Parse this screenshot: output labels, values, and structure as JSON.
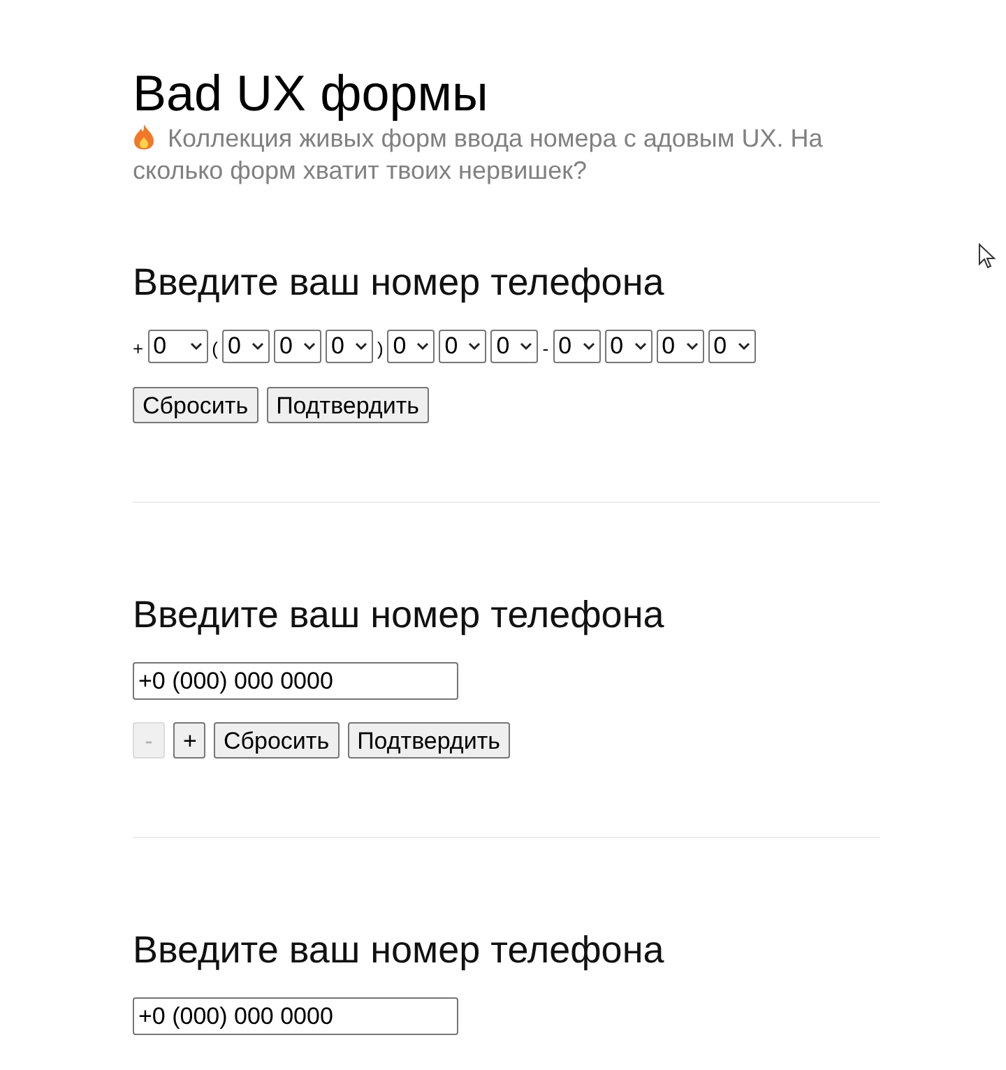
{
  "title": "Bad UX формы",
  "subtitle": "Коллекция живых форм ввода номера с адовым UX. На сколько форм хватит твоих нервишек?",
  "sections": [
    {
      "kind": "selects",
      "heading": "Введите ваш номер телефона",
      "parts": [
        {
          "kind": "sep",
          "text": "+"
        },
        {
          "kind": "select",
          "value": "0",
          "wide": true
        },
        {
          "kind": "sep",
          "text": "("
        },
        {
          "kind": "select",
          "value": "0",
          "wide": false
        },
        {
          "kind": "select",
          "value": "0",
          "wide": false
        },
        {
          "kind": "select",
          "value": "0",
          "wide": false
        },
        {
          "kind": "sep",
          "text": ")"
        },
        {
          "kind": "select",
          "value": "0",
          "wide": false
        },
        {
          "kind": "select",
          "value": "0",
          "wide": false
        },
        {
          "kind": "select",
          "value": "0",
          "wide": false
        },
        {
          "kind": "sep",
          "text": "-"
        },
        {
          "kind": "select",
          "value": "0",
          "wide": false
        },
        {
          "kind": "select",
          "value": "0",
          "wide": false
        },
        {
          "kind": "select",
          "value": "0",
          "wide": false
        },
        {
          "kind": "select",
          "value": "0",
          "wide": false
        }
      ],
      "buttons": [
        {
          "label": "Сбросить",
          "disabled": false
        },
        {
          "label": "Подтвердить",
          "disabled": false
        }
      ]
    },
    {
      "kind": "stepper",
      "heading": "Введите ваш номер телефона",
      "value": "+0 (000) 000 0000",
      "buttons": [
        {
          "label": "-",
          "disabled": true
        },
        {
          "label": "+",
          "disabled": false
        },
        {
          "label": "Сбросить",
          "disabled": false
        },
        {
          "label": "Подтвердить",
          "disabled": false
        }
      ]
    },
    {
      "kind": "stepper",
      "heading": "Введите ваш номер телефона",
      "value": "+0 (000) 000 0000"
    }
  ]
}
